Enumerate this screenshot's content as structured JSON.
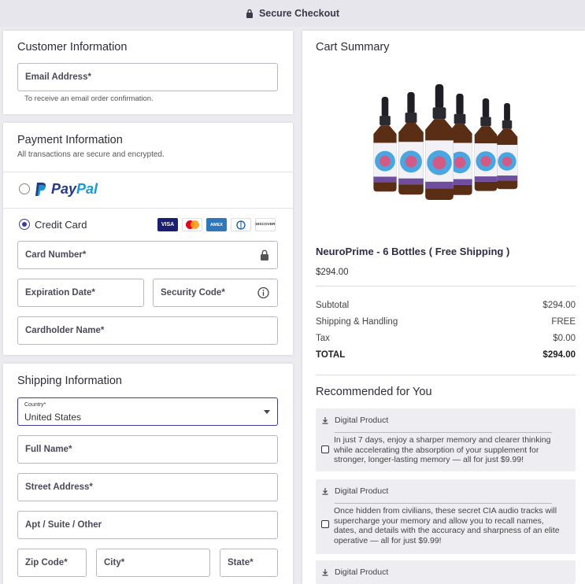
{
  "topbar": {
    "title": "Secure Checkout"
  },
  "customer": {
    "title": "Customer Information",
    "email_label": "Email Address*",
    "email_help": "To receive an email order confirmation."
  },
  "payment": {
    "title": "Payment Information",
    "subtitle": "All transactions are secure and encrypted.",
    "paypal_pay": "Pay",
    "paypal_pal": "Pal",
    "credit_label": "Credit Card",
    "card_logos": [
      "VISA",
      "Mastercard",
      "AMEX",
      "Diners",
      "DISCOVER"
    ],
    "card_number_label": "Card Number*",
    "expiration_label": "Expiration Date*",
    "security_label": "Security Code*",
    "holder_label": "Cardholder Name*"
  },
  "shipping": {
    "title": "Shipping Information",
    "country_label": "Country*",
    "country_value": "United States",
    "fullname_label": "Full Name*",
    "street_label": "Street Address*",
    "apt_label": "Apt / Suite / Other",
    "zip_label": "Zip Code*",
    "city_label": "City*",
    "state_label": "State*"
  },
  "cart": {
    "title": "Cart Summary",
    "product_name": "NeuroPrime - 6 Bottles ( Free Shipping )",
    "product_price": "$294.00",
    "product_brand": "NeuroPrime",
    "summary": [
      {
        "label": "Subtotal",
        "value": "$294.00"
      },
      {
        "label": "Shipping & Handling",
        "value": "FREE"
      },
      {
        "label": "Tax",
        "value": "$0.00"
      },
      {
        "label": "TOTAL",
        "value": "$294.00"
      }
    ]
  },
  "recommended": {
    "title": "Recommended for You",
    "items": [
      {
        "tag": "Digital Product",
        "text": "In just 7 days, enjoy a sharper memory and clearer thinking while accelerating the absorption of your supplement for stronger, longer-lasting memory — all for just $9.99!"
      },
      {
        "tag": "Digital Product",
        "text": "Once hidden from civilians, these secret CIA audio tracks will supercharge your memory and allow you to recall names, dates, and details with the accuracy and sharpness of an elite operative — all for just $9.99!"
      },
      {
        "tag": "Digital Product",
        "text": ""
      }
    ]
  },
  "colors": {
    "accent": "#3b3aa8",
    "paypal_dark": "#253b80",
    "paypal_light": "#179bd7"
  }
}
